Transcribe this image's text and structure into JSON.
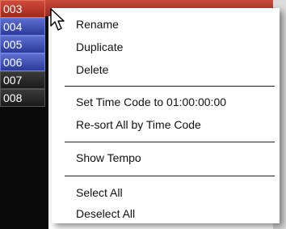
{
  "tracks": [
    "003",
    "004",
    "005",
    "006",
    "007",
    "008"
  ],
  "menu": {
    "items": [
      {
        "label": "Rename"
      },
      {
        "label": "Duplicate"
      },
      {
        "label": "Delete"
      },
      {
        "label": "Set Time Code to 01:00:00:00"
      },
      {
        "label": "Re-sort All by Time Code"
      },
      {
        "label": "Show Tempo"
      },
      {
        "label": "Select All"
      },
      {
        "label": "Deselect All"
      }
    ]
  },
  "colors": {
    "selected_row": "#c84a3c",
    "blue_row": "#3f52b8",
    "dark_row": "#2a2a2a",
    "menu_bg": "#ffffff"
  },
  "icons": {
    "cursor": "arrow-pointer-icon"
  }
}
